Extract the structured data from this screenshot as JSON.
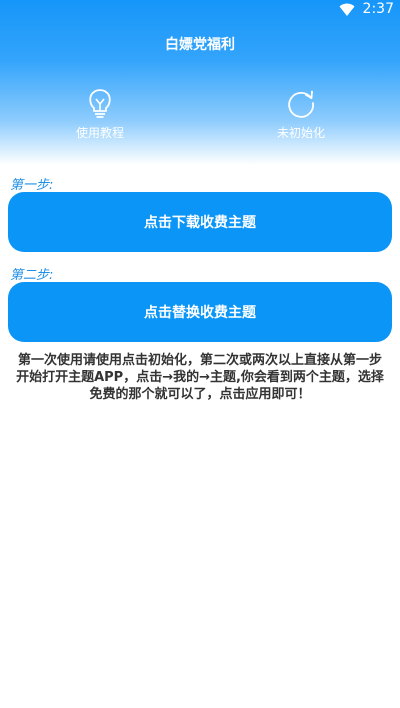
{
  "status_bar": {
    "time": "2:37",
    "wifi_icon": "wifi-icon"
  },
  "header": {
    "title": "白嫖党福利",
    "shortcuts": [
      {
        "label": "使用教程",
        "icon": "lightbulb-icon"
      },
      {
        "label": "未初始化",
        "icon": "refresh-icon"
      }
    ]
  },
  "steps": [
    {
      "label": "第一步:",
      "button_label": "点击下载收费主题"
    },
    {
      "label": "第二步:",
      "button_label": "点击替换收费主题"
    }
  ],
  "instructions": "第一次使用请使用点击初始化，第二次或两次以上直接从第一步开始打开主题APP，点击→我的→主题,你会看到两个主题，选择免费的那个就可以了，点击应用即可！",
  "colors": {
    "accent": "#0a95f7",
    "header_top": "#1696fa",
    "step_label": "#1f8fe6"
  }
}
